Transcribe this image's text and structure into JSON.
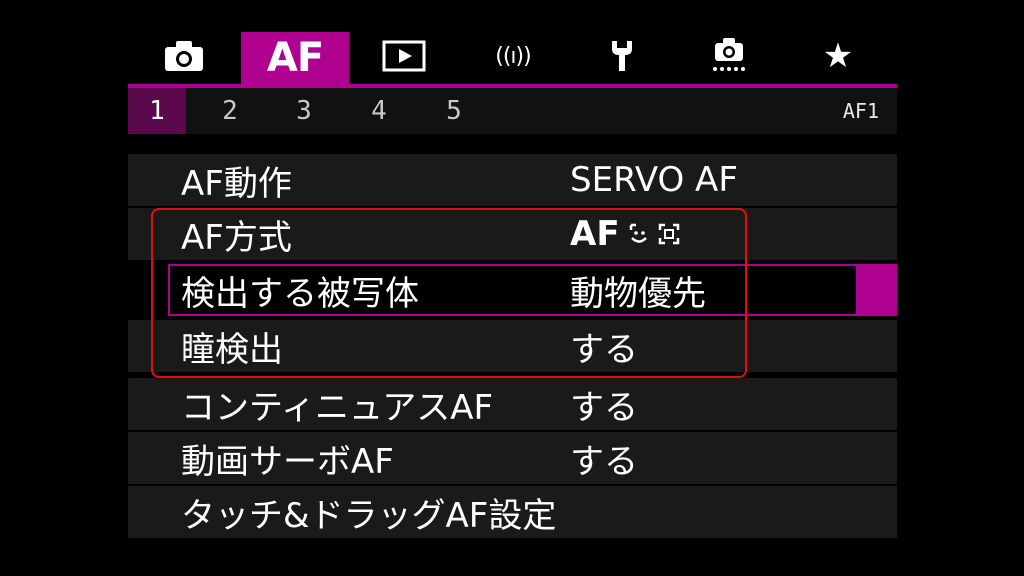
{
  "tabs": [
    {
      "id": "shooting",
      "icon": "camera-icon"
    },
    {
      "id": "af",
      "label": "AF"
    },
    {
      "id": "playback",
      "icon": "play-icon"
    },
    {
      "id": "wireless",
      "label": "((ı))",
      "icon": "wireless-icon"
    },
    {
      "id": "setup",
      "icon": "wrench-icon"
    },
    {
      "id": "custom",
      "icon": "custom-functions-icon"
    },
    {
      "id": "mymenu",
      "label": "★",
      "icon": "star-icon"
    }
  ],
  "subtabs": [
    "1",
    "2",
    "3",
    "4",
    "5"
  ],
  "page_code": "AF1",
  "menu": [
    {
      "label": "AF動作",
      "value": "SERVO AF"
    },
    {
      "label": "AF方式",
      "value": "AF",
      "value_icons": [
        "face-detect-icon",
        "tracking-frame-icon"
      ]
    },
    {
      "label": "検出する被写体",
      "value": "動物優先"
    },
    {
      "label": "瞳検出",
      "value": "する"
    },
    {
      "label": "コンティニュアスAF",
      "value": "する"
    },
    {
      "label": "動画サーボAF",
      "value": "する"
    },
    {
      "label": "タッチ&ドラッグAF設定",
      "value": ""
    }
  ],
  "colors": {
    "accent": "#b0008f",
    "highlight_box": "#e01010",
    "row_bg": "#1a1a1a",
    "subtab_active": "#5a0a4c"
  }
}
